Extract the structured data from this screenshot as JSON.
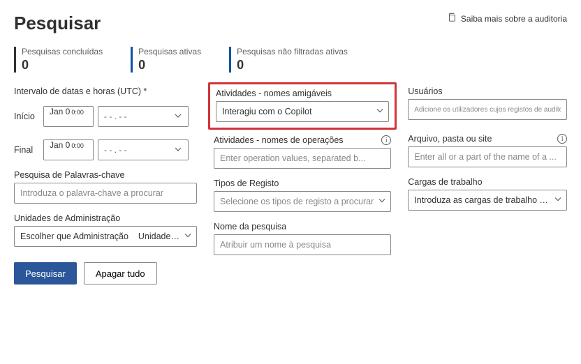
{
  "header": {
    "title": "Pesquisar",
    "learn": "Saiba mais sobre a auditoria"
  },
  "stats": {
    "completed_label": "Pesquisas concluídas",
    "completed_value": "0",
    "active_label": "Pesquisas ativas",
    "active_value": "0",
    "unfiltered_label": "Pesquisas não filtradas ativas",
    "unfiltered_value": "0"
  },
  "dates": {
    "range_label": "Intervalo de datas e horas (UTC) *",
    "start": "Início",
    "end": "Final",
    "jan": "Jan 0",
    "zerozero": "0:00",
    "time_placeholder": "- - . - -"
  },
  "keyword": {
    "label": "Pesquisa de Palavras-chave",
    "placeholder": "Introduza o palavra-chave a procurar"
  },
  "admin": {
    "label": "Unidades de Administração",
    "value1": "Escolher que Administração",
    "value2": "Unidades para"
  },
  "activities_friendly": {
    "label": "Atividades - nomes amigáveis",
    "value": "Interagiu com o Copilot"
  },
  "activities_ops": {
    "label": "Atividades - nomes de operações",
    "placeholder": "Enter operation values, separated b..."
  },
  "record_types": {
    "label": "Tipos de Registo",
    "placeholder": "Selecione os tipos de registo a procurar"
  },
  "search_name": {
    "label": "Nome da pesquisa",
    "placeholder": "Atribuir um nome à pesquisa"
  },
  "users": {
    "label": "Usuários",
    "placeholder": "Adicione os utilizadores cujos registos de auditoria o registam."
  },
  "file": {
    "label": "Arquivo, pasta ou site",
    "placeholder": "Enter all or a part of the name of a ..."
  },
  "workloads": {
    "label": "Cargas de trabalho",
    "placeholder": "Introduza as cargas de trabalho a procurar"
  },
  "buttons": {
    "search": "Pesquisar",
    "clear": "Apagar tudo"
  }
}
